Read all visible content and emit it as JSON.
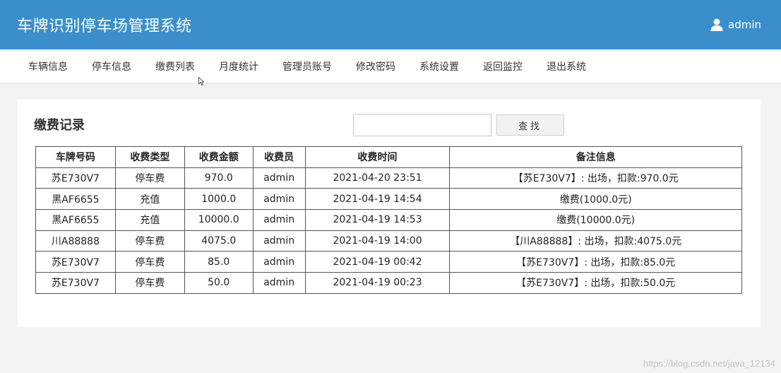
{
  "header": {
    "title": "车牌识别停车场管理系统",
    "user": "admin"
  },
  "nav": {
    "items": [
      "车辆信息",
      "停车信息",
      "缴费列表",
      "月度统计",
      "管理员账号",
      "修改密码",
      "系统设置",
      "返回监控",
      "退出系统"
    ]
  },
  "panel": {
    "title": "缴费记录",
    "search": {
      "value": "",
      "button": "查找"
    }
  },
  "table": {
    "headers": [
      "车牌号码",
      "收费类型",
      "收费金额",
      "收费员",
      "收费时间",
      "备注信息"
    ],
    "rows": [
      [
        "苏E730V7",
        "停车费",
        "970.0",
        "admin",
        "2021-04-20 23:51",
        "【苏E730V7】: 出场，扣款:970.0元"
      ],
      [
        "黑AF6655",
        "充值",
        "1000.0",
        "admin",
        "2021-04-19 14:54",
        "缴费(1000.0元)"
      ],
      [
        "黑AF6655",
        "充值",
        "10000.0",
        "admin",
        "2021-04-19 14:53",
        "缴费(10000.0元)"
      ],
      [
        "川A88888",
        "停车费",
        "4075.0",
        "admin",
        "2021-04-19 14:00",
        "【川A88888】: 出场，扣款:4075.0元"
      ],
      [
        "苏E730V7",
        "停车费",
        "85.0",
        "admin",
        "2021-04-19 00:42",
        "【苏E730V7】: 出场，扣款:85.0元"
      ],
      [
        "苏E730V7",
        "停车费",
        "50.0",
        "admin",
        "2021-04-19 00:23",
        "【苏E730V7】: 出场，扣款:50.0元"
      ]
    ]
  },
  "watermark": "https://blog.csdn.net/java_12134"
}
